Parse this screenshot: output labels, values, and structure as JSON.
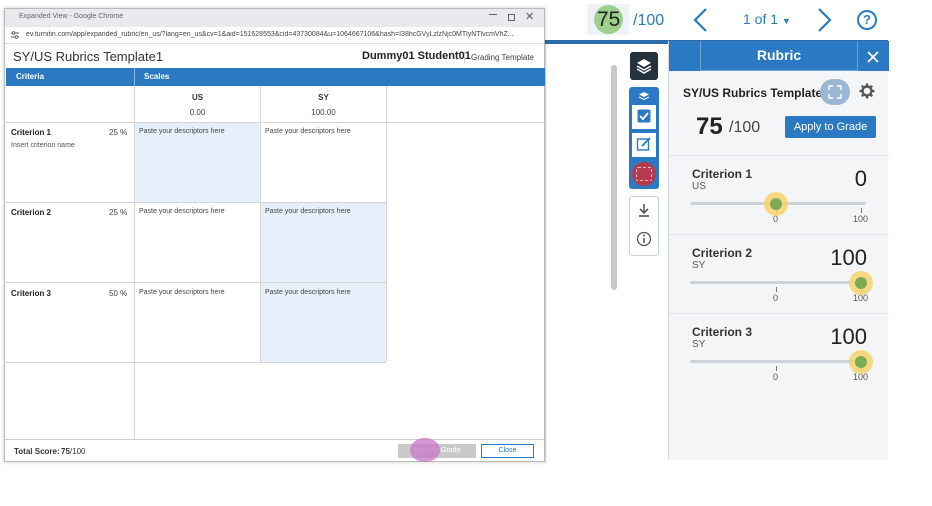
{
  "top_bar": {
    "score": "75",
    "score_max": "/100",
    "page_count": "1 of 1",
    "help": "?"
  },
  "popup": {
    "window_title": "Expanded View - Google Chrome",
    "url": "ev.turnitin.com/app/expanded_rubric/en_us/?lang=en_us&cv=1&aid=151628553&cid=43730084&u=1064667106&hash=I38hcGVyLzlzNjc0MTlyNTlvcmVhZ...",
    "rubric_title": "SY/US Rubrics Template1",
    "student": "Dummy01 Student01",
    "grading_template": "Grading Template",
    "col_criteria": "Criteria",
    "col_scales": "Scales",
    "scales": [
      {
        "name": "US",
        "value": "0.00"
      },
      {
        "name": "SY",
        "value": "100.00"
      }
    ],
    "criteria": [
      {
        "name": "Criterion 1",
        "weight": "25 %",
        "desc": "Insert criterion name",
        "cells": [
          "Paste your descriptors here",
          "Paste your descriptors here"
        ]
      },
      {
        "name": "Criterion 2",
        "weight": "25 %",
        "desc": "",
        "cells": [
          "Paste your descriptors here",
          "Paste your descriptors here"
        ]
      },
      {
        "name": "Criterion 3",
        "weight": "50 %",
        "desc": "",
        "cells": [
          "Paste your descriptors here",
          "Paste your descriptors here"
        ]
      }
    ],
    "total_label": "Total Score:",
    "total_score": "75",
    "total_max": "/100",
    "apply_label": "Apply to Grade",
    "close_label": "Close"
  },
  "rubric_panel": {
    "title": "Rubric",
    "rubric_name": "SY/US Rubrics Template1",
    "score": "75",
    "score_max": "/100",
    "apply_label": "Apply to Grade",
    "criteria": [
      {
        "name": "Criterion 1",
        "level": "US",
        "score": "0",
        "tick0": "0",
        "tick1": "100",
        "slider_value": 0
      },
      {
        "name": "Criterion 2",
        "level": "SY",
        "score": "100",
        "tick0": "0",
        "tick1": "100",
        "slider_value": 100
      },
      {
        "name": "Criterion 3",
        "level": "SY",
        "score": "100",
        "tick0": "0",
        "tick1": "100",
        "slider_value": 100
      }
    ]
  },
  "colors": {
    "primary": "#2b79c2",
    "dark_tool": "#25313c",
    "highlight_cell": "#e6f0fa",
    "score_green": "#8fc97a"
  }
}
